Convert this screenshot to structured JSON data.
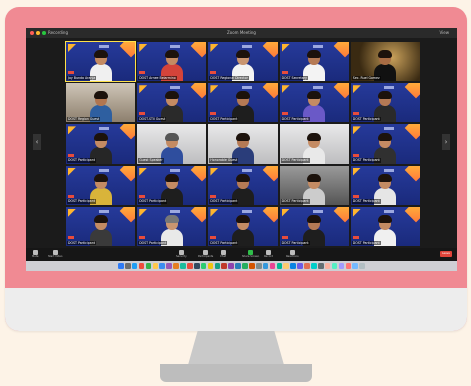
{
  "window": {
    "title": "Zoom Meeting",
    "recording_label": "Recording",
    "view_label": "View",
    "traffic_lights": [
      "#ff5f57",
      "#febc2e",
      "#28c840"
    ]
  },
  "tiles": [
    {
      "name": "Joy Bunda Aranja",
      "style": "blue",
      "skin": "#c48b63",
      "shirt": "#f0f0f0",
      "hair": "#1c120c",
      "speaking": true
    },
    {
      "name": "DOST Arnee Belarmino",
      "style": "blue",
      "skin": "#c48b63",
      "shirt": "#d4443a",
      "hair": "#1c120c"
    },
    {
      "name": "DOST Regional Director",
      "style": "blue",
      "skin": "#c99570",
      "shirt": "#f3f3f3",
      "hair": "#1c120c"
    },
    {
      "name": "DOST Secretary",
      "style": "blue",
      "skin": "#b57a55",
      "shirt": "#f3f3f3",
      "hair": "#1c120c"
    },
    {
      "name": "Sec. Ruel Gomez",
      "style": "gold",
      "skin": "#a86c44",
      "shirt": "#111111",
      "hair": "#1c120c"
    },
    {
      "name": "DOST Region Guest",
      "style": "room",
      "skin": "#b17650",
      "shirt": "#2e5fa0",
      "hair": "#1c120c"
    },
    {
      "name": "DOST-STII Guest",
      "style": "blue",
      "skin": "#c48b63",
      "shirt": "#2a2a2a",
      "hair": "#1c120c"
    },
    {
      "name": "DOST Participant",
      "style": "blue",
      "skin": "#b57a55",
      "shirt": "#1e1e1e",
      "hair": "#1c120c"
    },
    {
      "name": "DOST Participant",
      "style": "blue",
      "skin": "#c48b63",
      "shirt": "#6a59c7",
      "hair": "#1c120c"
    },
    {
      "name": "DOST Participant",
      "style": "blue",
      "skin": "#b57a55",
      "shirt": "#2a2a2a",
      "hair": "#1c120c"
    },
    {
      "name": "DOST Participant",
      "style": "blue",
      "skin": "#c48b63",
      "shirt": "#262626",
      "hair": "#1c120c"
    },
    {
      "name": "Guest Speaker",
      "style": "light",
      "skin": "#c48b63",
      "shirt": "#2f4e9e",
      "hair": "#555555"
    },
    {
      "name": "Honorable Guest",
      "style": "light",
      "skin": "#b57a55",
      "shirt": "#2a3d7a",
      "hair": "#1c120c"
    },
    {
      "name": "DOST Participant",
      "style": "light",
      "skin": "#c48b63",
      "shirt": "#e9e9e9",
      "hair": "#1c120c"
    },
    {
      "name": "DOST Participant",
      "style": "blue",
      "skin": "#c48b63",
      "shirt": "#303030",
      "hair": "#1c120c"
    },
    {
      "name": "DOST Participant",
      "style": "blue",
      "skin": "#c48b63",
      "shirt": "#d9b43a",
      "hair": "#1c120c"
    },
    {
      "name": "DOST Participant",
      "style": "blue",
      "skin": "#c48b63",
      "shirt": "#1e1e1e",
      "hair": "#1c120c"
    },
    {
      "name": "DOST Participant",
      "style": "blue",
      "skin": "#b57a55",
      "shirt": "#1e1e1e",
      "hair": "#1c120c"
    },
    {
      "name": "DOST Participant",
      "style": "grey",
      "skin": "#c48b63",
      "shirt": "#cccccc",
      "hair": "#1c120c"
    },
    {
      "name": "DOST Participant",
      "style": "blue",
      "skin": "#c48b63",
      "shirt": "#e6e6e6",
      "hair": "#1c120c"
    },
    {
      "name": "DOST Participant",
      "style": "blue",
      "skin": "#c48b63",
      "shirt": "#3a3a3a",
      "hair": "#1c120c"
    },
    {
      "name": "DOST Participant",
      "style": "blue",
      "skin": "#c99570",
      "shirt": "#e9e9e9",
      "hair": "#777777"
    },
    {
      "name": "DOST Participant",
      "style": "blue",
      "skin": "#c48b63",
      "shirt": "#1e1e1e",
      "hair": "#1c120c"
    },
    {
      "name": "DOST Participant",
      "style": "blue",
      "skin": "#b57a55",
      "shirt": "#1e1e1e",
      "hair": "#1c120c"
    },
    {
      "name": "DOST Participant",
      "style": "blue",
      "skin": "#c48b63",
      "shirt": "#f0f0f0",
      "hair": "#1c120c"
    }
  ],
  "controls": {
    "left": [
      {
        "label": "Mute",
        "icon": "microphone-icon"
      },
      {
        "label": "Start Video",
        "icon": "camera-icon"
      }
    ],
    "center": [
      {
        "label": "Security",
        "icon": "shield-icon"
      },
      {
        "label": "Participants",
        "icon": "people-icon"
      },
      {
        "label": "Chat",
        "icon": "chat-icon"
      },
      {
        "label": "Share Screen",
        "icon": "share-screen-icon",
        "color": "#2fbf4a"
      },
      {
        "label": "Record",
        "icon": "record-icon"
      },
      {
        "label": "Reactions",
        "icon": "smile-icon"
      }
    ],
    "leave_label": "Leave"
  },
  "dock": {
    "apps": [
      "#2f7bf6",
      "#6e6e6e",
      "#1f9ff5",
      "#f04b3b",
      "#37b34a",
      "#ffc84a",
      "#3a8df0",
      "#9b59b6",
      "#e67e22",
      "#1abc9c",
      "#e74c3c",
      "#34495e",
      "#2ecc71",
      "#f1c40f",
      "#16a085",
      "#c0392b",
      "#8e44ad",
      "#2980b9",
      "#27ae60",
      "#d35400",
      "#7f8c8d",
      "#3498db",
      "#e84393",
      "#00b894",
      "#fdcb6e",
      "#0984e3",
      "#6c5ce7",
      "#e17055",
      "#00cec9",
      "#636e72",
      "#fab1a0",
      "#55efc4",
      "#a29bfe",
      "#ff7675",
      "#74b9ff",
      "#b2bec3"
    ]
  }
}
